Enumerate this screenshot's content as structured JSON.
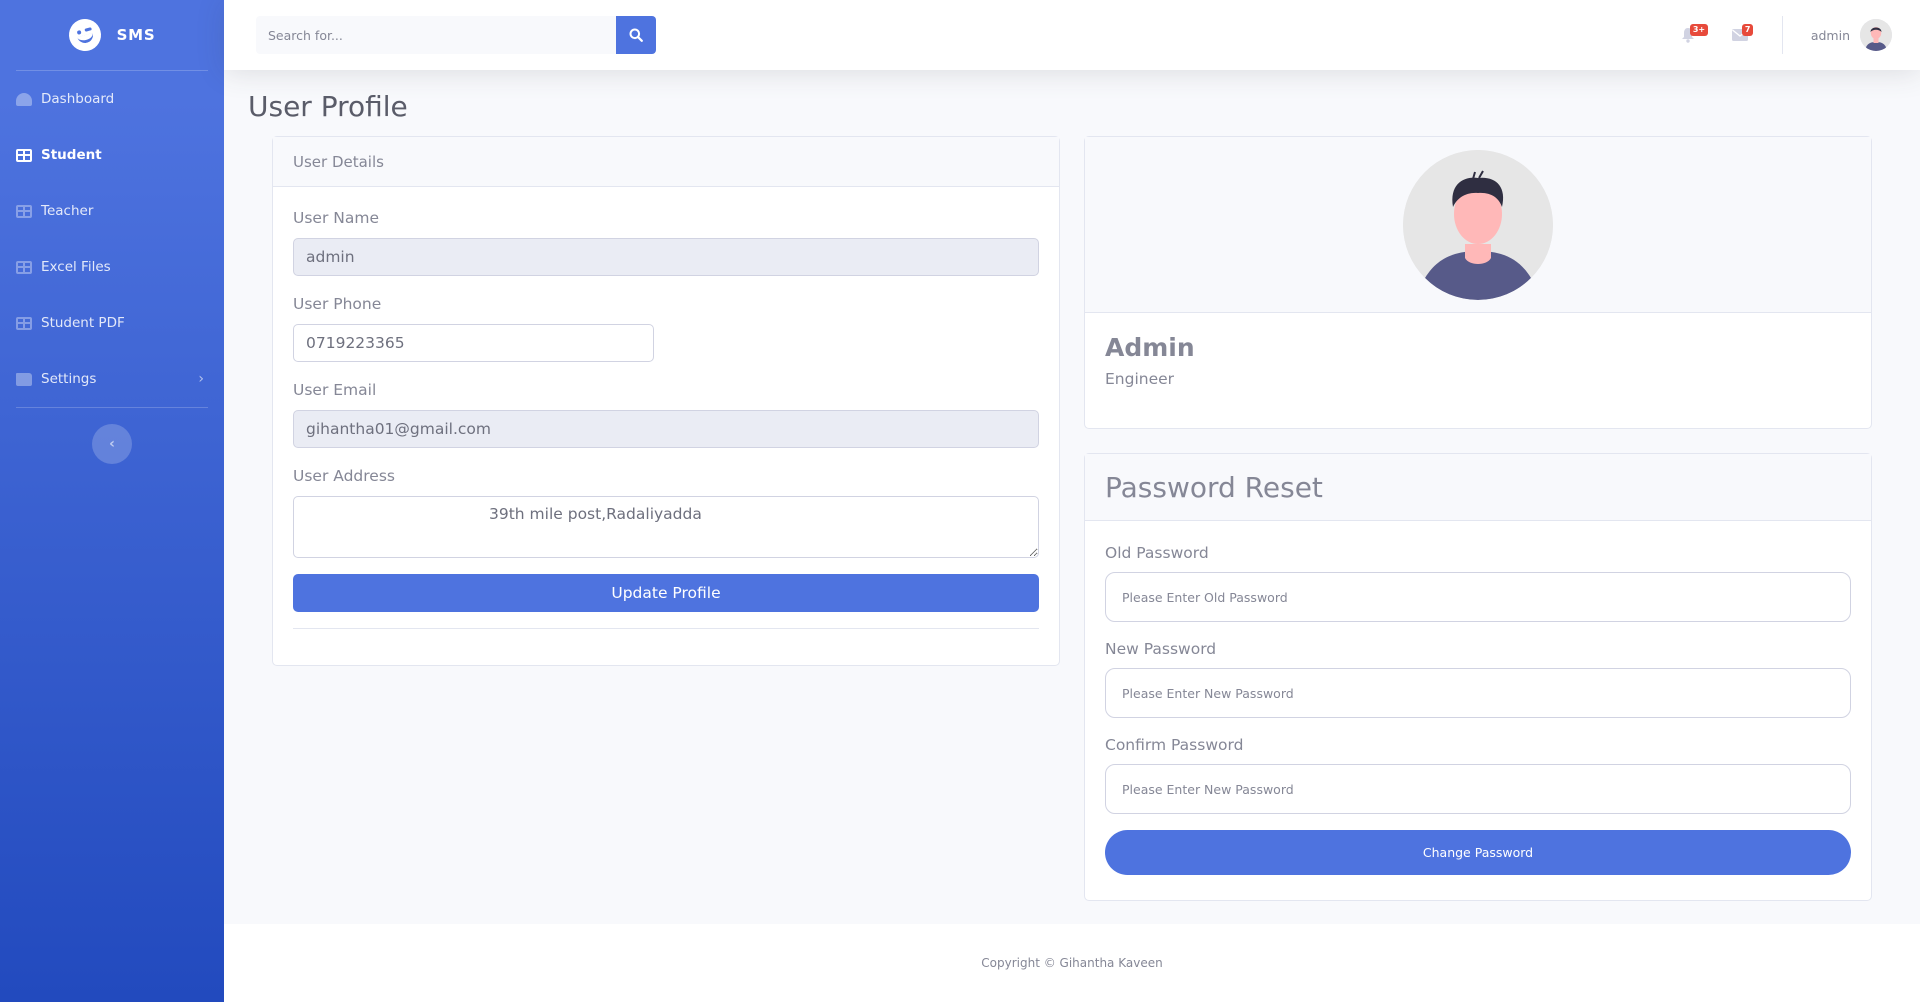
{
  "brand": {
    "name": "SMS",
    "logo_icon": "laugh-wink-icon"
  },
  "sidebar": {
    "items": [
      {
        "label": "Dashboard",
        "icon": "tachometer-icon",
        "active": false
      },
      {
        "label": "Student",
        "icon": "table-icon",
        "active": true
      },
      {
        "label": "Teacher",
        "icon": "table-icon",
        "active": false
      },
      {
        "label": "Excel Files",
        "icon": "table-icon",
        "active": false
      },
      {
        "label": "Student PDF",
        "icon": "table-icon",
        "active": false
      },
      {
        "label": "Settings",
        "icon": "folder-icon",
        "active": false,
        "has_submenu": true
      }
    ],
    "toggle_icon": "chevron-left-icon"
  },
  "topbar": {
    "search_placeholder": "Search for...",
    "alerts_badge": "3+",
    "messages_badge": "7",
    "user_name": "admin"
  },
  "page": {
    "title": "User Profile"
  },
  "user_details": {
    "header": "User Details",
    "username_label": "User Name",
    "username_value": "admin",
    "phone_label": "User Phone",
    "phone_value": "0719223365",
    "email_label": "User Email",
    "email_value": "gihantha01@gmail.com",
    "address_label": "User Address",
    "address_value": "39th mile post,Radaliyadda",
    "update_button": "Update Profile"
  },
  "profile_card": {
    "name": "Admin",
    "role": "Engineer"
  },
  "password_reset": {
    "title": "Password Reset",
    "old_label": "Old Password",
    "old_placeholder": "Please Enter Old Password",
    "new_label": "New Password",
    "new_placeholder": "Please Enter New Password",
    "confirm_label": "Confirm Password",
    "confirm_placeholder": "Please Enter New Password",
    "button": "Change Password"
  },
  "footer": {
    "text": "Copyright © Gihantha Kaveen"
  },
  "colors": {
    "primary": "#4e73df",
    "primary_dark": "#224abe",
    "danger": "#e74a3b",
    "text_muted": "#858796"
  }
}
